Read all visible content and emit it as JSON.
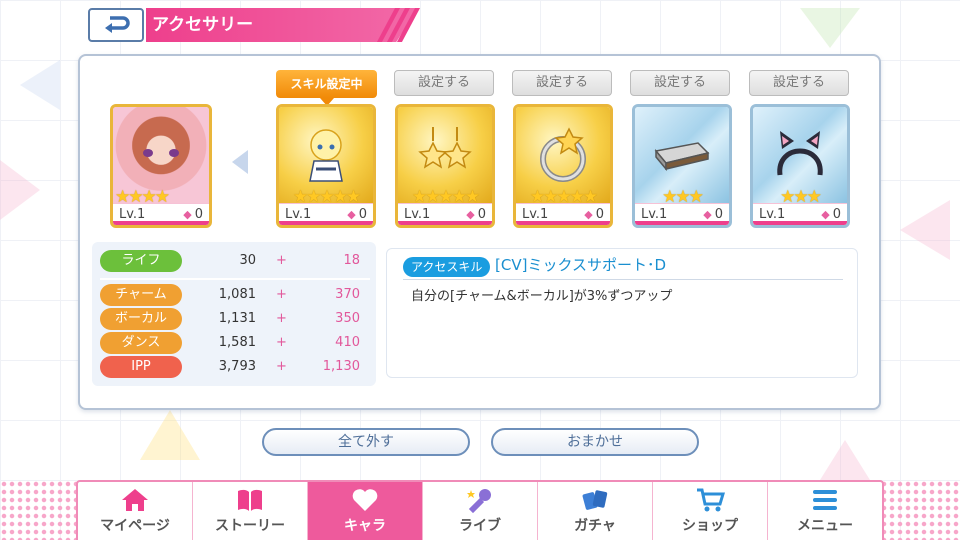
{
  "header": {
    "title": "アクセサリー"
  },
  "character": {
    "level": "Lv.1",
    "gem": "0",
    "stars": "★★★★"
  },
  "accessories": [
    {
      "top_label": "スキル設定中",
      "level": "Lv.1",
      "gem": "0",
      "stars": "★★★★★",
      "rarity": "gold",
      "icon": "chibi-character-icon"
    },
    {
      "top_label": "設定する",
      "level": "Lv.1",
      "gem": "0",
      "stars": "★★★★★",
      "rarity": "gold",
      "icon": "star-earrings-icon"
    },
    {
      "top_label": "設定する",
      "level": "Lv.1",
      "gem": "0",
      "stars": "★★★★★",
      "rarity": "gold",
      "icon": "star-ring-icon"
    },
    {
      "top_label": "設定する",
      "level": "Lv.1",
      "gem": "0",
      "stars": "★★★",
      "rarity": "blue",
      "icon": "harmonica-icon"
    },
    {
      "top_label": "設定する",
      "level": "Lv.1",
      "gem": "0",
      "stars": "★★★",
      "rarity": "blue",
      "icon": "cat-ear-headband-icon"
    }
  ],
  "stats": [
    {
      "label": "ライフ",
      "base": "30",
      "plus": "+",
      "bonus": "18",
      "color": "#6cc03b"
    },
    {
      "label": "チャーム",
      "base": "1,081",
      "plus": "+",
      "bonus": "370",
      "color": "#f0a032"
    },
    {
      "label": "ボーカル",
      "base": "1,131",
      "plus": "+",
      "bonus": "350",
      "color": "#f0a032"
    },
    {
      "label": "ダンス",
      "base": "1,581",
      "plus": "+",
      "bonus": "410",
      "color": "#f0a032"
    },
    {
      "label": "IPP",
      "base": "3,793",
      "plus": "+",
      "bonus": "1,130",
      "color": "#f0624d"
    }
  ],
  "skill": {
    "label": "アクセスキル",
    "name": "[CV]ミックスサポート･D",
    "description": "自分の[チャーム&ボーカル]が3%ずつアップ"
  },
  "buttons": {
    "remove_all": "全て外す",
    "auto": "おまかせ"
  },
  "nav": [
    {
      "label": "マイページ",
      "icon": "home-icon"
    },
    {
      "label": "ストーリー",
      "icon": "book-icon"
    },
    {
      "label": "キャラ",
      "icon": "heart-icon",
      "active": true
    },
    {
      "label": "ライブ",
      "icon": "microphone-icon"
    },
    {
      "label": "ガチャ",
      "icon": "cards-icon"
    },
    {
      "label": "ショップ",
      "icon": "cart-icon"
    },
    {
      "label": "メニュー",
      "icon": "menu-icon"
    }
  ]
}
